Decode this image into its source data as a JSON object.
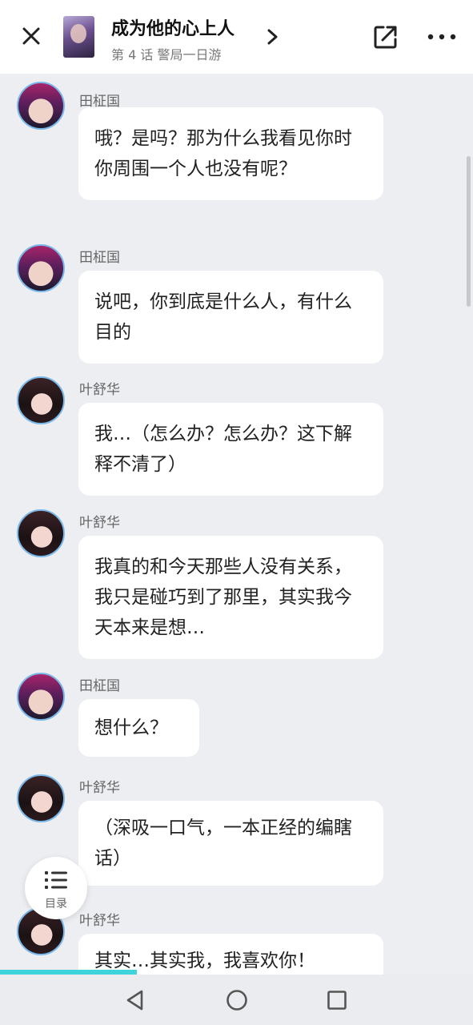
{
  "header": {
    "title": "成为他的心上人",
    "subtitle": "第 4 话 警局一日游",
    "icons": {
      "close": "close-icon",
      "chevron": "chevron-right-icon",
      "share": "share-icon",
      "more": "more-icon"
    }
  },
  "messages": [
    {
      "speaker": "田柾国",
      "avatar": "tian",
      "text": "哦？是吗？那为什么我看见你时你周围一个人也没有呢？"
    },
    {
      "speaker": "田柾国",
      "avatar": "tian",
      "text": "说吧，你到底是什么人，有什么目的"
    },
    {
      "speaker": "叶舒华",
      "avatar": "ye",
      "text": "我…（怎么办？怎么办？这下解释不清了）"
    },
    {
      "speaker": "叶舒华",
      "avatar": "ye",
      "text": "我真的和今天那些人没有关系，我只是碰巧到了那里，其实我今天本来是想…"
    },
    {
      "speaker": "田柾国",
      "avatar": "tian",
      "text": "想什么？"
    },
    {
      "speaker": "叶舒华",
      "avatar": "ye",
      "text": "（深吸一口气，一本正经的编瞎话）"
    },
    {
      "speaker": "叶舒华",
      "avatar": "ye",
      "text": "其实…其实我，我喜欢你！"
    }
  ],
  "toc": {
    "label": "目录",
    "icon": "list-icon"
  },
  "progress": {
    "fraction": 0.29,
    "color": "#3fd3dc"
  },
  "navbar": {
    "icons": [
      "back-triangle-icon",
      "home-circle-icon",
      "recent-square-icon"
    ]
  }
}
